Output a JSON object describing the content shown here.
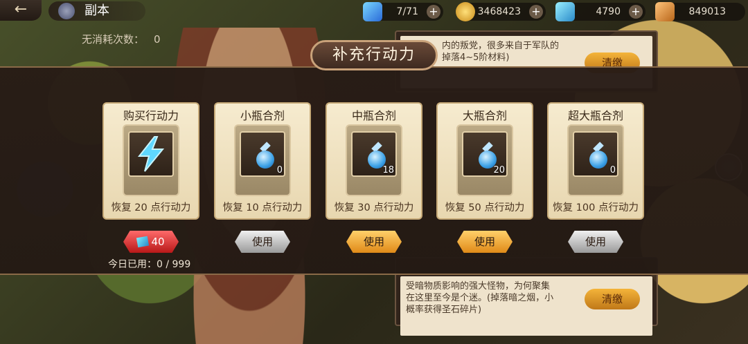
{
  "header": {
    "back_icon": "back-arrow-icon",
    "title": "副本",
    "stamina": "7/71",
    "gold": "3468423",
    "gems": "4790",
    "other": "849013",
    "free_count_label": "无消耗次数：",
    "free_count_value": "0"
  },
  "bg_quests": [
    {
      "text": "内的叛党，很多来自于军队的\n掉落4~5阶材料)",
      "button": "清缴"
    },
    {
      "text": "受暗物质影响的强大怪物，为何聚集\n在这里至今是个迷。(掉落暗之烟，小\n概率获得圣石碎片)",
      "button": "清缴"
    }
  ],
  "popup": {
    "title": "补充行动力",
    "cards": [
      {
        "name": "购买行动力",
        "qty": "",
        "desc": "恢复 20 点行动力",
        "button": "40",
        "button_style": "red"
      },
      {
        "name": "小瓶合剂",
        "qty": "0",
        "desc": "恢复 10 点行动力",
        "button": "使用",
        "button_style": "gray"
      },
      {
        "name": "中瓶合剂",
        "qty": "18",
        "desc": "恢复 30 点行动力",
        "button": "使用",
        "button_style": "orange"
      },
      {
        "name": "大瓶合剂",
        "qty": "20",
        "desc": "恢复 50 点行动力",
        "button": "使用",
        "button_style": "orange"
      },
      {
        "name": "超大瓶合剂",
        "qty": "0",
        "desc": "恢复 100 点行动力",
        "button": "使用",
        "button_style": "gray"
      }
    ],
    "used_today_label": "今日已用：",
    "used_today_value": "0 / 999"
  }
}
